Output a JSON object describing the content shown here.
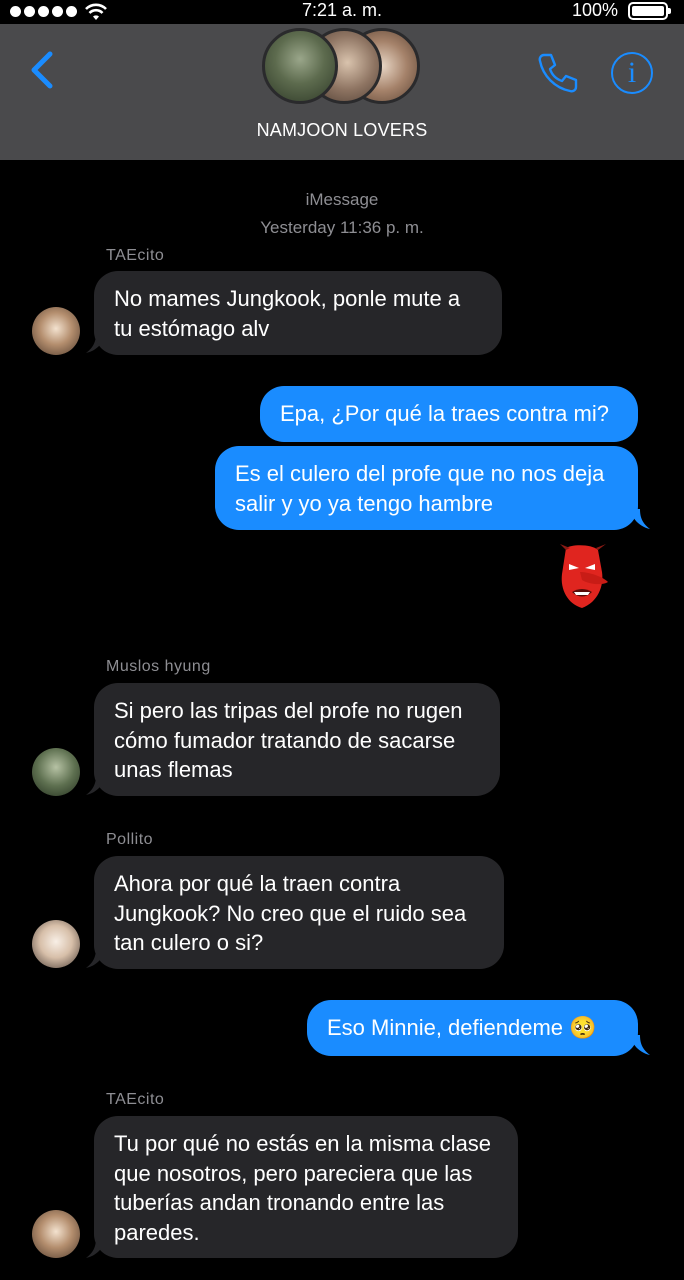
{
  "status_bar": {
    "time": "7:21 a. m.",
    "battery": "100%"
  },
  "header": {
    "group_name": "NAMJOON LOVERS"
  },
  "conversation": {
    "service": "iMessage",
    "timestamp": "Yesterday 11:36 p. m."
  },
  "messages": [
    {
      "sender": "TAEcito",
      "text": "No mames Jungkook, ponle mute a tu estómago alv"
    },
    {
      "text": "Epa, ¿Por qué la traes contra mi?"
    },
    {
      "text": "Es el culero del profe que no nos deja salir y yo ya tengo hambre"
    },
    {
      "sticker": "red-mask-emoji"
    },
    {
      "sender": "Muslos hyung",
      "text": "Si pero las tripas del profe no rugen cómo fumador tratando de sacarse unas flemas"
    },
    {
      "sender": "Pollito",
      "text": "Ahora por qué la traen contra Jungkook? No creo que el ruido sea tan culero o si?"
    },
    {
      "text": "Eso Minnie, defiendeme 🥺"
    },
    {
      "sender": "TAEcito",
      "text": "Tu por qué no estás en la misma clase que nosotros, pero pareciera que las tuberías andan tronando entre las paredes."
    }
  ],
  "colors": {
    "accent": "#1a8cff",
    "incoming_bubble": "#262629",
    "header_bg": "#4a4a4c"
  }
}
